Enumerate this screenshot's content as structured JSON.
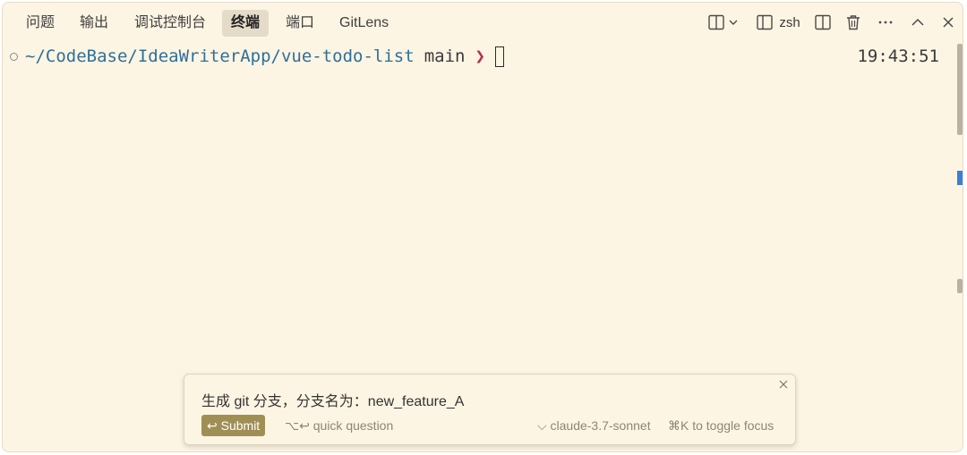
{
  "tabs": [
    {
      "label": "问题",
      "active": false
    },
    {
      "label": "输出",
      "active": false
    },
    {
      "label": "调试控制台",
      "active": false
    },
    {
      "label": "终端",
      "active": true
    },
    {
      "label": "端口",
      "active": false
    },
    {
      "label": "GitLens",
      "active": false
    }
  ],
  "toolbar": {
    "shell_name": "zsh",
    "icons": [
      "split-terminal-icon",
      "chevron-down-icon",
      "terminal-icon",
      "split-panel-icon",
      "trash-icon",
      "ellipsis-icon",
      "chevron-up-icon",
      "close-icon"
    ]
  },
  "terminal": {
    "path": "~/CodeBase/IdeaWriterApp/vue-todo-list",
    "branch": "main",
    "prompt_symbol": "❯",
    "time": "19:43:51"
  },
  "ai_popup": {
    "prompt_text": "生成 git 分支，分支名为：new_feature_A",
    "submit_label": "↩ Submit",
    "quick_question": "⌥↩ quick question",
    "model": "claude-3.7-sonnet",
    "model_caret": "⌵",
    "toggle_focus": "⌘K to toggle focus"
  },
  "colors": {
    "background": "#fdf5e3",
    "path": "#2f6f9a",
    "prompt_symbol": "#b3304e",
    "submit_bg": "#a08f55",
    "scroll_marker": "#3a7fd5"
  }
}
